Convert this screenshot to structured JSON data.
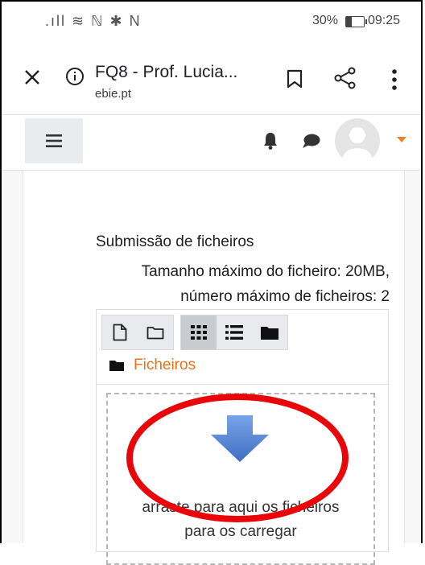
{
  "status_bar": {
    "signal_icons": ".ıll ≋ ℕ ✱ N",
    "battery": "30%",
    "time": "09:25"
  },
  "browser": {
    "tab_title": "FQ8 - Prof. Lucia...",
    "url": "ebie.pt"
  },
  "content": {
    "submission_label": "Submissão de ficheiros",
    "max_size": "Tamanho máximo do ficheiro: 20MB,",
    "max_files": "número máximo de ficheiros: 2",
    "folder_path": "Ficheiros",
    "drop_line1": "arraste para aqui os ficheiros",
    "drop_line2": "para os carregar"
  },
  "colors": {
    "accent_orange": "#e8731a",
    "annotation_red": "#e8060a",
    "arrow_blue": "#5a86d6"
  }
}
